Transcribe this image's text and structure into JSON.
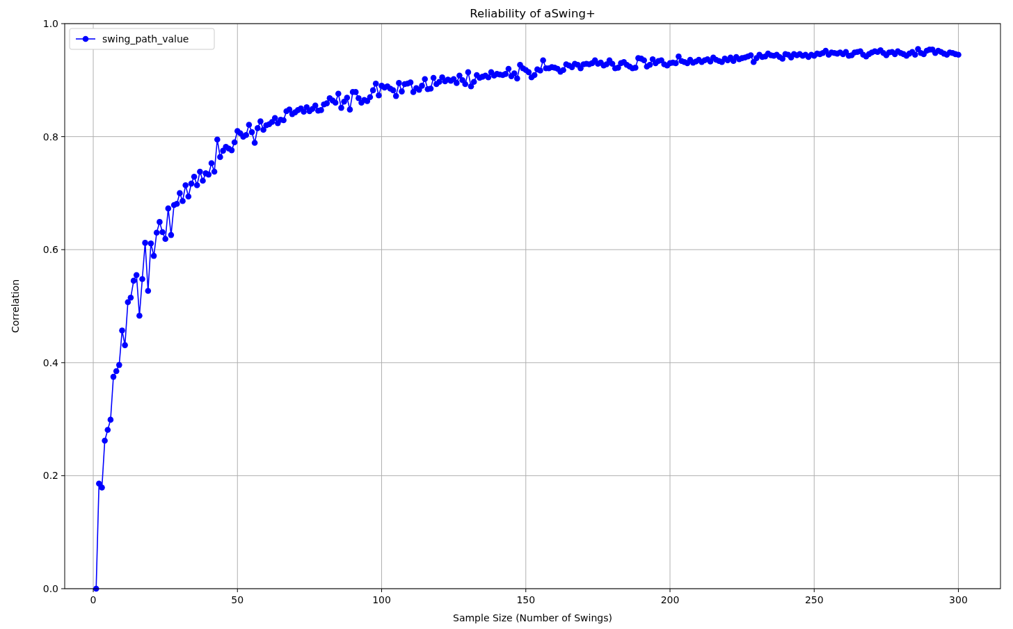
{
  "figure": {
    "chart_data": {
      "type": "line",
      "title": "Reliability of aSwing+",
      "xlabel": "Sample Size (Number of Swings)",
      "ylabel": "Correlation",
      "x": [
        1,
        2,
        3,
        4,
        5,
        6,
        7,
        8,
        9,
        10,
        11,
        12,
        13,
        14,
        15,
        16,
        17,
        18,
        19,
        20,
        21,
        22,
        23,
        24,
        25,
        26,
        27,
        28,
        29,
        30,
        31,
        32,
        33,
        34,
        35,
        36,
        37,
        38,
        39,
        40,
        41,
        42,
        43,
        44,
        45,
        46,
        47,
        48,
        49,
        50,
        51,
        52,
        53,
        54,
        55,
        56,
        57,
        58,
        59,
        60,
        61,
        62,
        63,
        64,
        65,
        66,
        67,
        68,
        69,
        70,
        71,
        72,
        73,
        74,
        75,
        76,
        77,
        78,
        79,
        80,
        81,
        82,
        83,
        84,
        85,
        86,
        87,
        88,
        89,
        90,
        91,
        92,
        93,
        94,
        95,
        96,
        97,
        98,
        99,
        100,
        101,
        102,
        103,
        104,
        105,
        106,
        107,
        108,
        109,
        110,
        111,
        112,
        113,
        114,
        115,
        116,
        117,
        118,
        119,
        120,
        121,
        122,
        123,
        124,
        125,
        126,
        127,
        128,
        129,
        130,
        131,
        132,
        133,
        134,
        135,
        136,
        137,
        138,
        139,
        140,
        141,
        142,
        143,
        144,
        145,
        146,
        147,
        148,
        149,
        150,
        151,
        152,
        153,
        154,
        155,
        156,
        157,
        158,
        159,
        160,
        161,
        162,
        163,
        164,
        165,
        166,
        167,
        168,
        169,
        170,
        171,
        172,
        173,
        174,
        175,
        176,
        177,
        178,
        179,
        180,
        181,
        182,
        183,
        184,
        185,
        186,
        187,
        188,
        189,
        190,
        191,
        192,
        193,
        194,
        195,
        196,
        197,
        198,
        199,
        200,
        201,
        202,
        203,
        204,
        205,
        206,
        207,
        208,
        209,
        210,
        211,
        212,
        213,
        214,
        215,
        216,
        217,
        218,
        219,
        220,
        221,
        222,
        223,
        224,
        225,
        226,
        227,
        228,
        229,
        230,
        231,
        232,
        233,
        234,
        235,
        236,
        237,
        238,
        239,
        240,
        241,
        242,
        243,
        244,
        245,
        246,
        247,
        248,
        249,
        250,
        251,
        252,
        253,
        254,
        255,
        256,
        257,
        258,
        259,
        260,
        261,
        262,
        263,
        264,
        265,
        266,
        267,
        268,
        269,
        270,
        271,
        272,
        273,
        274,
        275,
        276,
        277,
        278,
        279,
        280,
        281,
        282,
        283,
        284,
        285,
        286,
        287,
        288,
        289,
        290,
        291,
        292,
        293,
        294,
        295,
        296,
        297,
        298,
        299,
        300
      ],
      "grid": true,
      "series": [
        {
          "name": "swing_path_value",
          "color": "#0000ff",
          "marker": "o",
          "values": [
            0.0,
            0.186,
            0.179,
            0.262,
            0.281,
            0.299,
            0.375,
            0.385,
            0.396,
            0.457,
            0.431,
            0.507,
            0.515,
            0.545,
            0.555,
            0.483,
            0.548,
            0.612,
            0.527,
            0.611,
            0.589,
            0.63,
            0.649,
            0.631,
            0.619,
            0.673,
            0.626,
            0.679,
            0.681,
            0.7,
            0.686,
            0.714,
            0.694,
            0.717,
            0.729,
            0.714,
            0.738,
            0.722,
            0.735,
            0.733,
            0.753,
            0.738,
            0.795,
            0.764,
            0.775,
            0.782,
            0.779,
            0.776,
            0.79,
            0.81,
            0.806,
            0.8,
            0.803,
            0.821,
            0.808,
            0.789,
            0.815,
            0.827,
            0.812,
            0.82,
            0.822,
            0.826,
            0.833,
            0.824,
            0.83,
            0.829,
            0.845,
            0.848,
            0.84,
            0.843,
            0.847,
            0.85,
            0.844,
            0.852,
            0.845,
            0.849,
            0.855,
            0.846,
            0.847,
            0.857,
            0.859,
            0.868,
            0.864,
            0.86,
            0.876,
            0.851,
            0.862,
            0.869,
            0.848,
            0.879,
            0.879,
            0.868,
            0.86,
            0.865,
            0.863,
            0.87,
            0.882,
            0.894,
            0.873,
            0.89,
            0.887,
            0.889,
            0.885,
            0.882,
            0.872,
            0.895,
            0.88,
            0.893,
            0.894,
            0.896,
            0.879,
            0.886,
            0.883,
            0.89,
            0.902,
            0.884,
            0.885,
            0.904,
            0.893,
            0.897,
            0.905,
            0.898,
            0.901,
            0.899,
            0.902,
            0.895,
            0.908,
            0.9,
            0.893,
            0.914,
            0.889,
            0.897,
            0.909,
            0.904,
            0.906,
            0.908,
            0.905,
            0.914,
            0.908,
            0.911,
            0.91,
            0.909,
            0.911,
            0.92,
            0.907,
            0.912,
            0.903,
            0.927,
            0.921,
            0.918,
            0.914,
            0.905,
            0.909,
            0.919,
            0.917,
            0.935,
            0.921,
            0.921,
            0.923,
            0.922,
            0.92,
            0.915,
            0.918,
            0.928,
            0.926,
            0.923,
            0.929,
            0.927,
            0.921,
            0.928,
            0.929,
            0.928,
            0.93,
            0.935,
            0.929,
            0.931,
            0.926,
            0.928,
            0.935,
            0.929,
            0.921,
            0.922,
            0.93,
            0.932,
            0.927,
            0.924,
            0.921,
            0.922,
            0.939,
            0.938,
            0.935,
            0.924,
            0.927,
            0.937,
            0.93,
            0.934,
            0.935,
            0.928,
            0.926,
            0.93,
            0.931,
            0.93,
            0.942,
            0.934,
            0.932,
            0.93,
            0.936,
            0.931,
            0.933,
            0.936,
            0.932,
            0.935,
            0.937,
            0.933,
            0.94,
            0.936,
            0.934,
            0.932,
            0.938,
            0.935,
            0.94,
            0.934,
            0.941,
            0.937,
            0.939,
            0.94,
            0.942,
            0.944,
            0.932,
            0.939,
            0.945,
            0.941,
            0.942,
            0.947,
            0.944,
            0.943,
            0.945,
            0.941,
            0.938,
            0.946,
            0.945,
            0.94,
            0.946,
            0.944,
            0.946,
            0.943,
            0.945,
            0.941,
            0.945,
            0.943,
            0.947,
            0.946,
            0.948,
            0.952,
            0.945,
            0.949,
            0.948,
            0.947,
            0.949,
            0.946,
            0.95,
            0.943,
            0.944,
            0.949,
            0.95,
            0.951,
            0.945,
            0.942,
            0.946,
            0.949,
            0.951,
            0.95,
            0.953,
            0.948,
            0.944,
            0.949,
            0.95,
            0.946,
            0.951,
            0.948,
            0.946,
            0.943,
            0.947,
            0.95,
            0.945,
            0.955,
            0.948,
            0.946,
            0.952,
            0.954,
            0.954,
            0.948,
            0.952,
            0.95,
            0.947,
            0.945,
            0.949,
            0.948,
            0.946,
            0.945
          ]
        }
      ],
      "xlim": [
        -9.9,
        314.6
      ],
      "ylim": [
        0,
        1
      ],
      "xticks": [
        0,
        50,
        100,
        150,
        200,
        250,
        300
      ],
      "yticks": [
        {
          "value": 0,
          "label": "0.0"
        },
        {
          "value": 0.2,
          "label": "0.2"
        },
        {
          "value": 0.4,
          "label": "0.4"
        },
        {
          "value": 0.6,
          "label": "0.6"
        },
        {
          "value": 0.8,
          "label": "0.8"
        },
        {
          "value": 1,
          "label": "1.0"
        }
      ]
    }
  }
}
